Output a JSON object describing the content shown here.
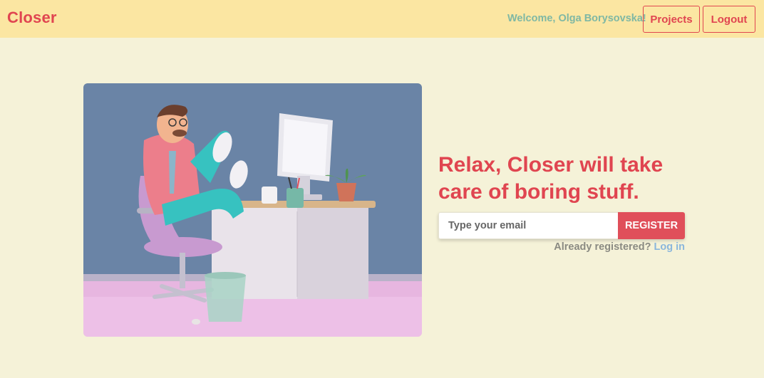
{
  "navbar": {
    "brand": "Closer",
    "welcome": "Welcome, Olga Borysovska!",
    "projects_label": "Projects",
    "logout_label": "Logout"
  },
  "hero": {
    "headline_line1": "Relax, Closer will take",
    "headline_line2": "care of boring stuff.",
    "email_placeholder": "Type your email",
    "register_label": "REGISTER",
    "already_text": "Already registered?",
    "login_link": "Log in"
  },
  "colors": {
    "accent": "#e04550",
    "navbar_bg": "#fbe6a2",
    "page_bg": "#f5f2d8",
    "welcome_text": "#7fb8a4",
    "link": "#8ab6dc"
  }
}
